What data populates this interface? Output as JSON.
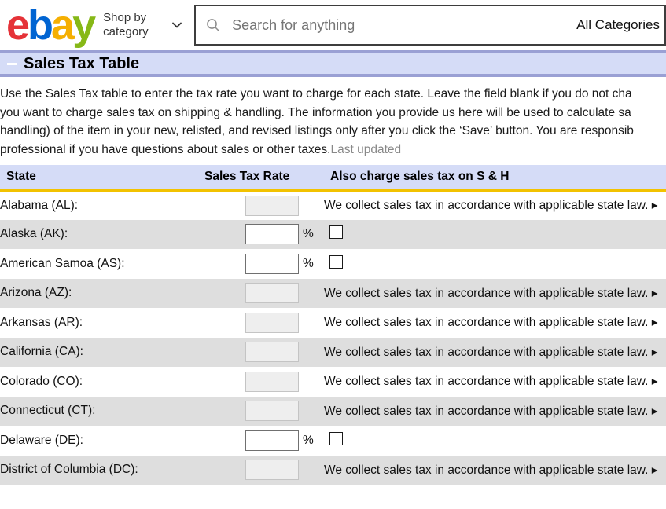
{
  "header": {
    "logo": {
      "e": "e",
      "b": "b",
      "a": "a",
      "y": "y"
    },
    "shop_by_category": "Shop by category",
    "search_placeholder": "Search for anything",
    "category_selector": "All Categories"
  },
  "section": {
    "title": "Sales Tax Table",
    "collapse_label": "−"
  },
  "intro": {
    "line1": "Use the Sales Tax table to enter the tax rate you want to charge for each state. Leave the field blank if you do not cha",
    "line2": "you want to charge sales tax on shipping & handling. The information you provide us here will be used to calculate sa",
    "line3": "handling) of the item in your new, relisted, and revised listings only after you click the ‘Save’ button. You are responsib",
    "line4_main": "professional if you have questions about sales or other taxes.",
    "line4_muted": "Last updated"
  },
  "table": {
    "columns": {
      "state": "State",
      "rate": "Sales Tax Rate",
      "sh": "Also charge sales tax on S & H"
    },
    "collected_note": "We collect sales tax in accordance with applicable state law.",
    "percent_symbol": "%",
    "rows": [
      {
        "state": "Alabama (AL):",
        "editable": false
      },
      {
        "state": "Alaska (AK):",
        "editable": true,
        "rate": ""
      },
      {
        "state": "American Samoa (AS):",
        "editable": true,
        "rate": ""
      },
      {
        "state": "Arizona (AZ):",
        "editable": false
      },
      {
        "state": "Arkansas (AR):",
        "editable": false
      },
      {
        "state": "California (CA):",
        "editable": false
      },
      {
        "state": "Colorado (CO):",
        "editable": false
      },
      {
        "state": "Connecticut (CT):",
        "editable": false
      },
      {
        "state": "Delaware (DE):",
        "editable": true,
        "rate": ""
      },
      {
        "state": "District of Columbia (DC):",
        "editable": false
      }
    ]
  },
  "colors": {
    "section_bar": "#d5dcf7",
    "section_border": "#9aa0d4",
    "header_rule": "#f2c200",
    "stripe": "#dedede",
    "logo_red": "#e53238",
    "logo_blue": "#0064d2",
    "logo_yellow": "#f5af02",
    "logo_green": "#86b817"
  }
}
